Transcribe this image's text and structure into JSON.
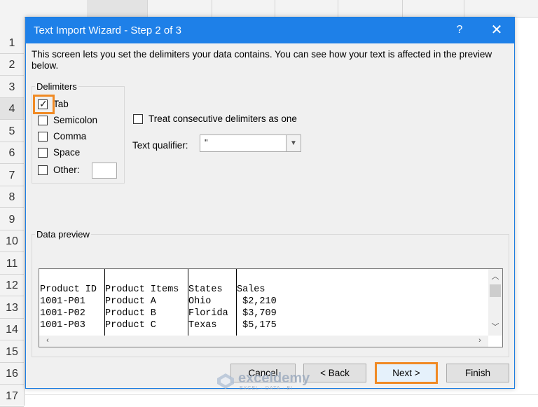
{
  "excel": {
    "row_numbers": [
      "1",
      "2",
      "3",
      "4",
      "5",
      "6",
      "7",
      "8",
      "9",
      "10",
      "11",
      "12",
      "13",
      "14",
      "15",
      "16",
      "17"
    ]
  },
  "dialog": {
    "title": "Text Import Wizard - Step 2 of 3",
    "help_label": "?",
    "close_label": "✕",
    "description": "This screen lets you set the delimiters your data contains.  You can see how your text is affected in the preview below.",
    "delimiters": {
      "group_label": "Delimiters",
      "tab": {
        "label": "Tab",
        "checked": true
      },
      "semicolon": {
        "label": "Semicolon",
        "checked": false
      },
      "comma": {
        "label": "Comma",
        "checked": false
      },
      "space": {
        "label": "Space",
        "checked": false
      },
      "other": {
        "label": "Other:",
        "checked": false,
        "value": ""
      }
    },
    "treat_consecutive": {
      "label": "Treat consecutive delimiters as one",
      "checked": false
    },
    "text_qualifier": {
      "label": "Text qualifier:",
      "value": "\""
    },
    "preview": {
      "group_label": "Data preview",
      "headers": [
        "Product ID",
        "Product Items",
        "States",
        "Sales"
      ],
      "rows": [
        [
          "1001-P01",
          "Product A",
          "Ohio",
          " $2,210"
        ],
        [
          "1001-P02",
          "Product B",
          "Florida",
          " $3,709"
        ],
        [
          "1001-P03",
          "Product C",
          "Texas",
          " $5,175"
        ]
      ]
    },
    "buttons": {
      "cancel": "Cancel",
      "back": "< Back",
      "next": "Next >",
      "finish": "Finish"
    }
  },
  "watermark": {
    "name": "exceldemy",
    "tagline": "EXCEL · DATA · BI"
  },
  "colors": {
    "titlebar": "#1e80e8",
    "highlight": "#f08a24",
    "dialog_bg": "#f0f0f0"
  }
}
